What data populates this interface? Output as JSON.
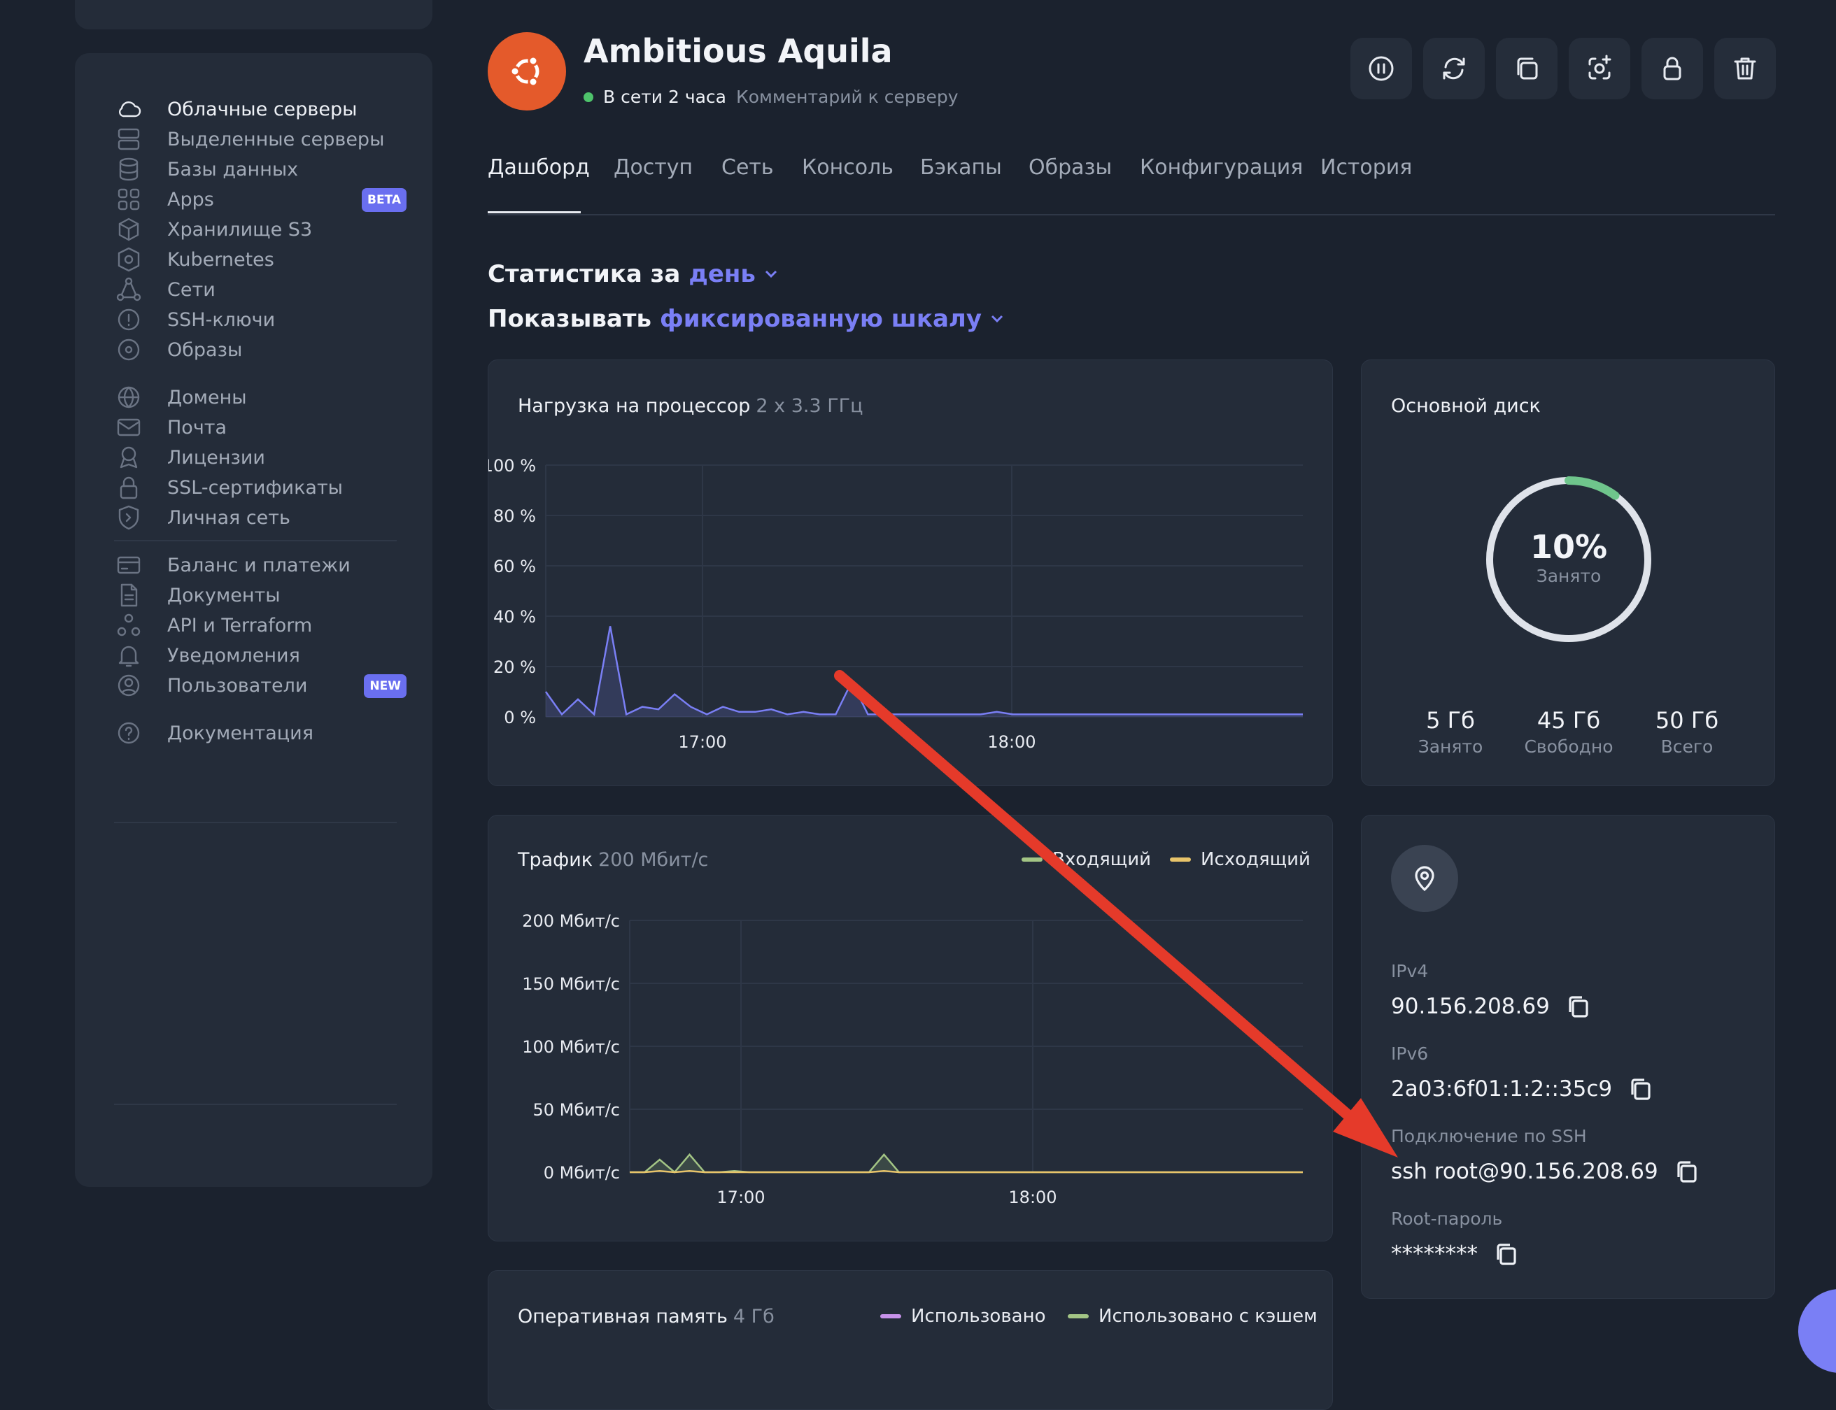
{
  "sidebar": {
    "items": [
      {
        "label": "Облачные серверы",
        "icon": "cloud-icon",
        "active": true
      },
      {
        "label": "Выделенные серверы",
        "icon": "server-icon"
      },
      {
        "label": "Базы данных",
        "icon": "database-icon"
      },
      {
        "label": "Apps",
        "icon": "apps-grid-icon",
        "badge": "BETA"
      },
      {
        "label": "Хранилище S3",
        "icon": "cube-icon"
      },
      {
        "label": "Kubernetes",
        "icon": "kubernetes-icon"
      },
      {
        "label": "Сети",
        "icon": "network-icon"
      },
      {
        "label": "SSH-ключи",
        "icon": "key-icon"
      },
      {
        "label": "Образы",
        "icon": "disc-icon"
      },
      {
        "label": "Домены",
        "icon": "globe-icon"
      },
      {
        "label": "Почта",
        "icon": "mail-icon"
      },
      {
        "label": "Лицензии",
        "icon": "license-icon"
      },
      {
        "label": "SSL-сертификаты",
        "icon": "lock-icon"
      },
      {
        "label": "Личная сеть",
        "icon": "shield-icon"
      },
      {
        "label": "Баланс и платежи",
        "icon": "card-icon"
      },
      {
        "label": "Документы",
        "icon": "document-icon"
      },
      {
        "label": "API и Terraform",
        "icon": "api-icon"
      },
      {
        "label": "Уведомления",
        "icon": "bell-icon"
      },
      {
        "label": "Пользователи",
        "icon": "user-icon",
        "badge": "NEW"
      },
      {
        "label": "Документация",
        "icon": "help-icon"
      }
    ]
  },
  "server": {
    "name": "Ambitious Aquila",
    "status": "В сети 2 часа",
    "comment": "Комментарий к серверу",
    "status_color": "#4ec36b",
    "avatar_color": "#e45a2b",
    "avatar_icon": "ubuntu-logo-icon"
  },
  "toolbar": [
    "pause-icon",
    "reboot-icon",
    "clone-icon",
    "snapshot-icon",
    "lock-icon",
    "trash-icon"
  ],
  "tabs": [
    "Дашборд",
    "Доступ",
    "Сеть",
    "Консоль",
    "Бэкапы",
    "Образы",
    "Конфигурация",
    "История"
  ],
  "stats": {
    "period_prefix": "Статистика за",
    "period": "день",
    "scale_prefix": "Показывать",
    "scale": "фиксированную шкалу"
  },
  "cpu": {
    "title": "Нагрузка на процессор",
    "spec": "2 x 3.3 ГГц"
  },
  "traffic": {
    "title": "Трафик",
    "spec": "200 Мбит/с",
    "legend_in": "Входящий",
    "legend_out": "Исходящий"
  },
  "ram": {
    "title": "Оперативная память",
    "spec": "4 Гб",
    "legend_used": "Использовано",
    "legend_cached": "Использовано с кэшем"
  },
  "disk": {
    "title": "Основной диск",
    "percent": "10%",
    "percent_label": "Занято",
    "fraction": 0.1,
    "used": "5 Гб",
    "used_label": "Занято",
    "free": "45 Гб",
    "free_label": "Свободно",
    "total": "50 Гб",
    "total_label": "Всего"
  },
  "info": {
    "ipv4_label": "IPv4",
    "ipv4": "90.156.208.69",
    "ipv6_label": "IPv6",
    "ipv6": "2a03:6f01:1:2::35c9",
    "ssh_label": "Подключение по SSH",
    "ssh": "ssh root@90.156.208.69",
    "root_label": "Root-пароль",
    "root": "********"
  },
  "colors": {
    "accent": "#7a7ff5",
    "cpu_line": "#7a7ff5",
    "traffic_in": "#a3c585",
    "traffic_out": "#e8c46a",
    "ram_used": "#c792ea",
    "ram_cached": "#a3c585",
    "arrow": "#e53a2a"
  },
  "chart_data": [
    {
      "type": "area",
      "title": "Нагрузка на процессор 2 x 3.3 ГГц",
      "ylim": [
        0,
        100
      ],
      "y_ticks": [
        "100 %",
        "80 %",
        "60 %",
        "40 %",
        "20 %",
        "0 %"
      ],
      "x_ticks": [
        "17:00",
        "18:00"
      ],
      "series": [
        {
          "values": [
            10,
            1,
            7,
            1,
            36,
            1,
            4,
            3,
            9,
            4,
            1,
            4,
            2,
            2,
            3,
            1,
            2,
            1,
            1,
            14,
            1,
            1,
            1,
            1,
            1,
            1,
            1,
            1,
            2,
            1,
            1,
            1,
            1,
            1,
            1,
            1,
            1,
            1,
            1,
            1,
            1,
            1,
            1,
            1,
            1,
            1,
            1,
            1
          ]
        }
      ]
    },
    {
      "type": "area",
      "title": "Трафик 200 Мбит/с",
      "ylim": [
        0,
        200
      ],
      "y_ticks": [
        "200 Мбит/с",
        "150 Мбит/с",
        "100 Мбит/с",
        "50 Мбит/с",
        "0 Мбит/с"
      ],
      "x_ticks": [
        "17:00",
        "18:00"
      ],
      "series": [
        {
          "name": "Входящий",
          "values": [
            0,
            0,
            10,
            0,
            14,
            0,
            0,
            1,
            0,
            0,
            0,
            0,
            0,
            0,
            0,
            0,
            0,
            14,
            0,
            0,
            0,
            0,
            0,
            0,
            0,
            0,
            0,
            0,
            0,
            0,
            0,
            0,
            0,
            0,
            0,
            0,
            0,
            0,
            0,
            0,
            0,
            0,
            0,
            0,
            0,
            0
          ]
        },
        {
          "name": "Исходящий",
          "values": [
            0,
            0,
            1,
            0,
            1,
            0,
            0,
            0,
            0,
            0,
            0,
            0,
            0,
            0,
            0,
            0,
            0,
            1,
            0,
            0,
            0,
            0,
            0,
            0,
            0,
            0,
            0,
            0,
            0,
            0,
            0,
            0,
            0,
            0,
            0,
            0,
            0,
            0,
            0,
            0,
            0,
            0,
            0,
            0,
            0,
            0
          ]
        }
      ]
    }
  ]
}
